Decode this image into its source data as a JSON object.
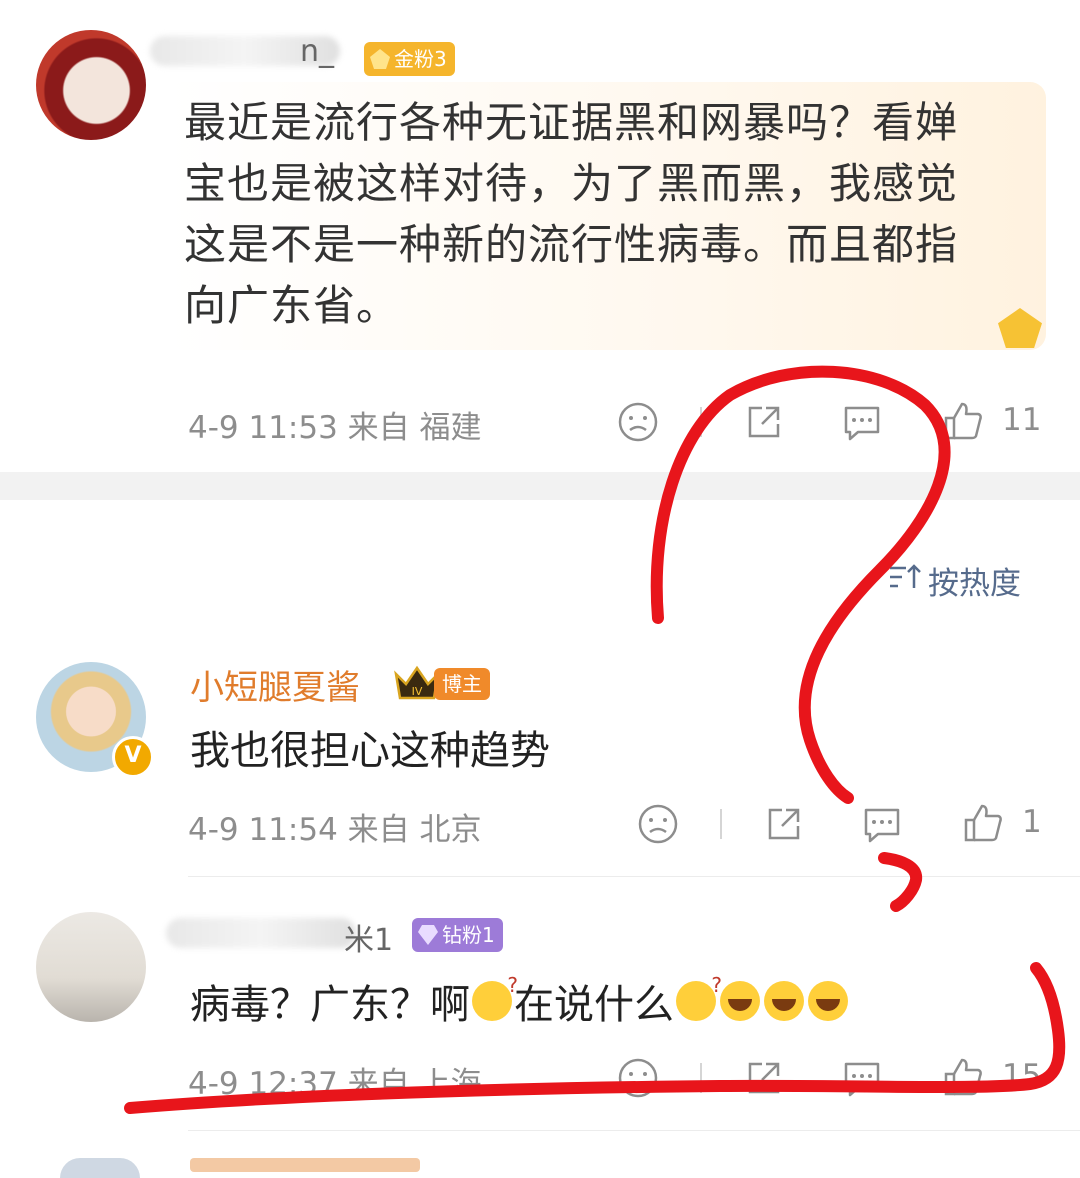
{
  "comments": [
    {
      "name_tail": "n_",
      "badge": "金粉3",
      "text": "最近是流行各种无证据黑和网暴吗？看婵宝也是被这样对待，为了黑而黑，我感觉这是不是一种新的流行性病毒。而且都指向广东省。",
      "meta": "4-9 11:53 来自 福建",
      "likes": "11"
    },
    {
      "name": "小短腿夏酱",
      "badge": "博主",
      "text": "我也很担心这种趋势",
      "meta": "4-9 11:54 来自 北京",
      "likes": "1"
    },
    {
      "name_tail": "米1",
      "badge": "钻粉1",
      "text_parts": [
        "病毒？广东？啊",
        "在说什么"
      ],
      "meta": "4-9 12:37 来自 上海",
      "likes": "15"
    }
  ],
  "sort": {
    "label": "按热度"
  },
  "colors": {
    "annotation": "#e8151b",
    "name_orange": "#e07c2c",
    "sort_blue": "#566b8c"
  }
}
